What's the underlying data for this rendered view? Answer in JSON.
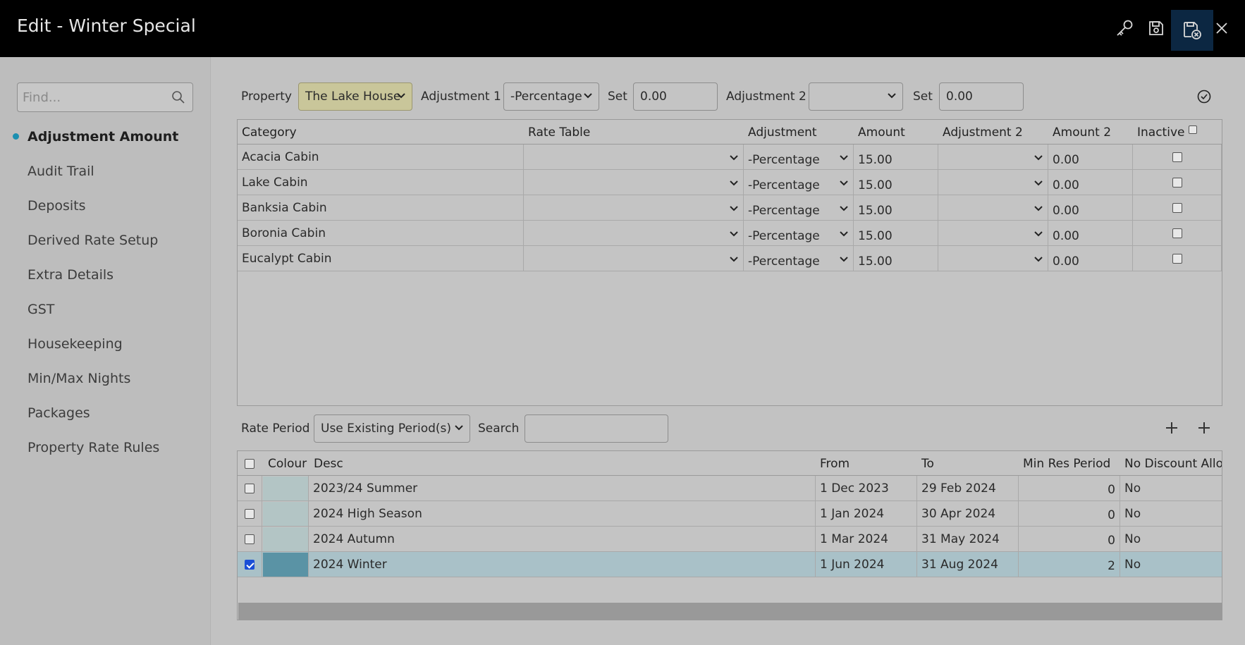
{
  "header": {
    "title": "Edit - Winter Special"
  },
  "sidebar": {
    "find_placeholder": "Find...",
    "items": [
      {
        "label": "Adjustment Amount"
      },
      {
        "label": "Audit Trail"
      },
      {
        "label": "Deposits"
      },
      {
        "label": "Derived Rate Setup"
      },
      {
        "label": "Extra Details"
      },
      {
        "label": "GST"
      },
      {
        "label": "Housekeeping"
      },
      {
        "label": "Min/Max Nights"
      },
      {
        "label": "Packages"
      },
      {
        "label": "Property Rate Rules"
      }
    ]
  },
  "filters": {
    "property_label": "Property",
    "property_value": "The Lake House",
    "adjustment1_label": "Adjustment 1",
    "adjustment1_value": "-Percentage",
    "set1_label": "Set",
    "set1_value": "0.00",
    "adjustment2_label": "Adjustment 2",
    "adjustment2_value": "",
    "set2_label": "Set",
    "set2_value": "0.00"
  },
  "categories_table": {
    "headers": {
      "category": "Category",
      "rate_table": "Rate Table",
      "adjustment": "Adjustment",
      "amount": "Amount",
      "adjustment2": "Adjustment 2",
      "amount2": "Amount 2",
      "inactive": "Inactive"
    },
    "rows": [
      {
        "category": "Acacia Cabin",
        "rate_table": "",
        "adjustment": "-Percentage",
        "amount": "15.00",
        "adjustment2": "",
        "amount2": "0.00",
        "inactive": false
      },
      {
        "category": "Lake Cabin",
        "rate_table": "",
        "adjustment": "-Percentage",
        "amount": "15.00",
        "adjustment2": "",
        "amount2": "0.00",
        "inactive": false
      },
      {
        "category": "Banksia Cabin",
        "rate_table": "",
        "adjustment": "-Percentage",
        "amount": "15.00",
        "adjustment2": "",
        "amount2": "0.00",
        "inactive": false
      },
      {
        "category": "Boronia Cabin",
        "rate_table": "",
        "adjustment": "-Percentage",
        "amount": "15.00",
        "adjustment2": "",
        "amount2": "0.00",
        "inactive": false
      },
      {
        "category": "Eucalypt Cabin",
        "rate_table": "",
        "adjustment": "-Percentage",
        "amount": "15.00",
        "adjustment2": "",
        "amount2": "0.00",
        "inactive": false
      }
    ]
  },
  "rate_period": {
    "label": "Rate Period",
    "value": "Use Existing Period(s)",
    "search_label": "Search",
    "search_value": ""
  },
  "periods_table": {
    "headers": {
      "colour": "Colour",
      "desc": "Desc",
      "from": "From",
      "to": "To",
      "min_res_period": "Min Res Period",
      "no_discount": "No Discount Allow"
    },
    "rows": [
      {
        "checked": false,
        "colour": "#b3c5c5",
        "desc": "2023/24 Summer",
        "from": "1 Dec 2023",
        "to": "29 Feb 2024",
        "min_res": "0",
        "no_discount": "No"
      },
      {
        "checked": false,
        "colour": "#b3c5c5",
        "desc": "2024 High Season",
        "from": "1 Jan 2024",
        "to": "30 Apr 2024",
        "min_res": "0",
        "no_discount": "No"
      },
      {
        "checked": false,
        "colour": "#b3c5c5",
        "desc": "2024 Autumn",
        "from": "1 Mar 2024",
        "to": "31 May 2024",
        "min_res": "0",
        "no_discount": "No"
      },
      {
        "checked": true,
        "colour": "#5a93a5",
        "desc": "2024 Winter",
        "from": "1 Jun 2024",
        "to": "31 Aug 2024",
        "min_res": "2",
        "no_discount": "No"
      }
    ]
  },
  "icons": {
    "key": "key-icon",
    "save": "save-icon",
    "save_close": "save-close-icon",
    "close": "close-icon",
    "search": "search-icon",
    "confirm": "check-circle-icon",
    "add": "plus-icon",
    "dropdown": "chevron-down-icon"
  }
}
